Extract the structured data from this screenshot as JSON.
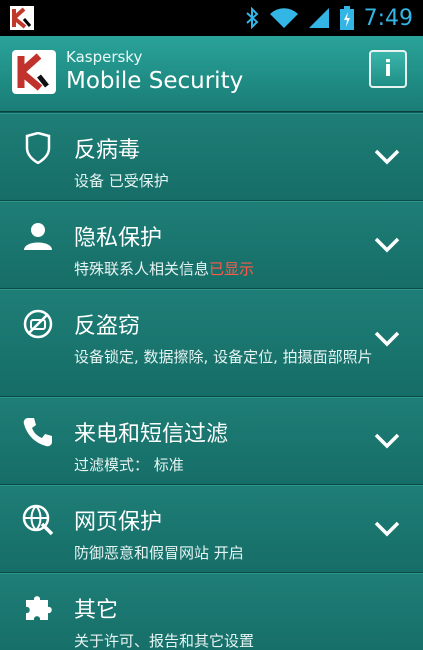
{
  "status_bar": {
    "time": "7:49"
  },
  "header": {
    "brand": "Kaspersky",
    "product": "Mobile Security",
    "info_label": "i"
  },
  "sections": [
    {
      "icon": "shield-icon",
      "title": "反病毒",
      "subtitle": "设备 已受保护",
      "highlight": ""
    },
    {
      "icon": "person-icon",
      "title": "隐私保护",
      "subtitle": "特殊联系人相关信息",
      "highlight": "已显示"
    },
    {
      "icon": "anti-theft-icon",
      "title": "反盗窃",
      "subtitle": "设备锁定, 数据擦除, 设备定位, 拍摄面部照片",
      "highlight": ""
    },
    {
      "icon": "phone-icon",
      "title": "来电和短信过滤",
      "subtitle": "过滤模式： 标准",
      "highlight": ""
    },
    {
      "icon": "globe-icon",
      "title": "网页保护",
      "subtitle": "防御恶意和假冒网站 开启",
      "highlight": ""
    },
    {
      "icon": "puzzle-icon",
      "title": "其它",
      "subtitle": "关于许可、报告和其它设置",
      "highlight": ""
    }
  ],
  "colors": {
    "accent": "#33b5e5",
    "row_bg": "#1e7e77",
    "highlight": "#ff5a4a"
  }
}
